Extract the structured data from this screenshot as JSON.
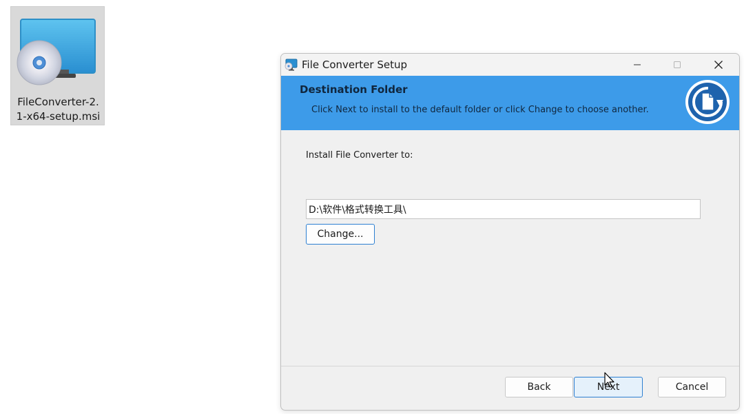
{
  "desktop": {
    "file_icon": {
      "label_line1": "FileConverter-2.",
      "label_line2": "1-x64-setup.msi",
      "icon": "installer-disc-icon"
    }
  },
  "window": {
    "title": "File Converter Setup",
    "controls": {
      "minimize": "—",
      "maximize": "□",
      "close": "✕"
    },
    "banner": {
      "heading": "Destination Folder",
      "subtext": "Click Next to install to the default folder or click Change to choose another.",
      "bg_color": "#3d9be9",
      "logo_icon": "file-convert-logo-icon"
    },
    "content": {
      "install_label": "Install File Converter to:",
      "path_value": "D:\\软件\\格式转换工具\\",
      "change_label": "Change..."
    },
    "footer": {
      "back_label": "Back",
      "next_label": "Next",
      "cancel_label": "Cancel"
    }
  }
}
